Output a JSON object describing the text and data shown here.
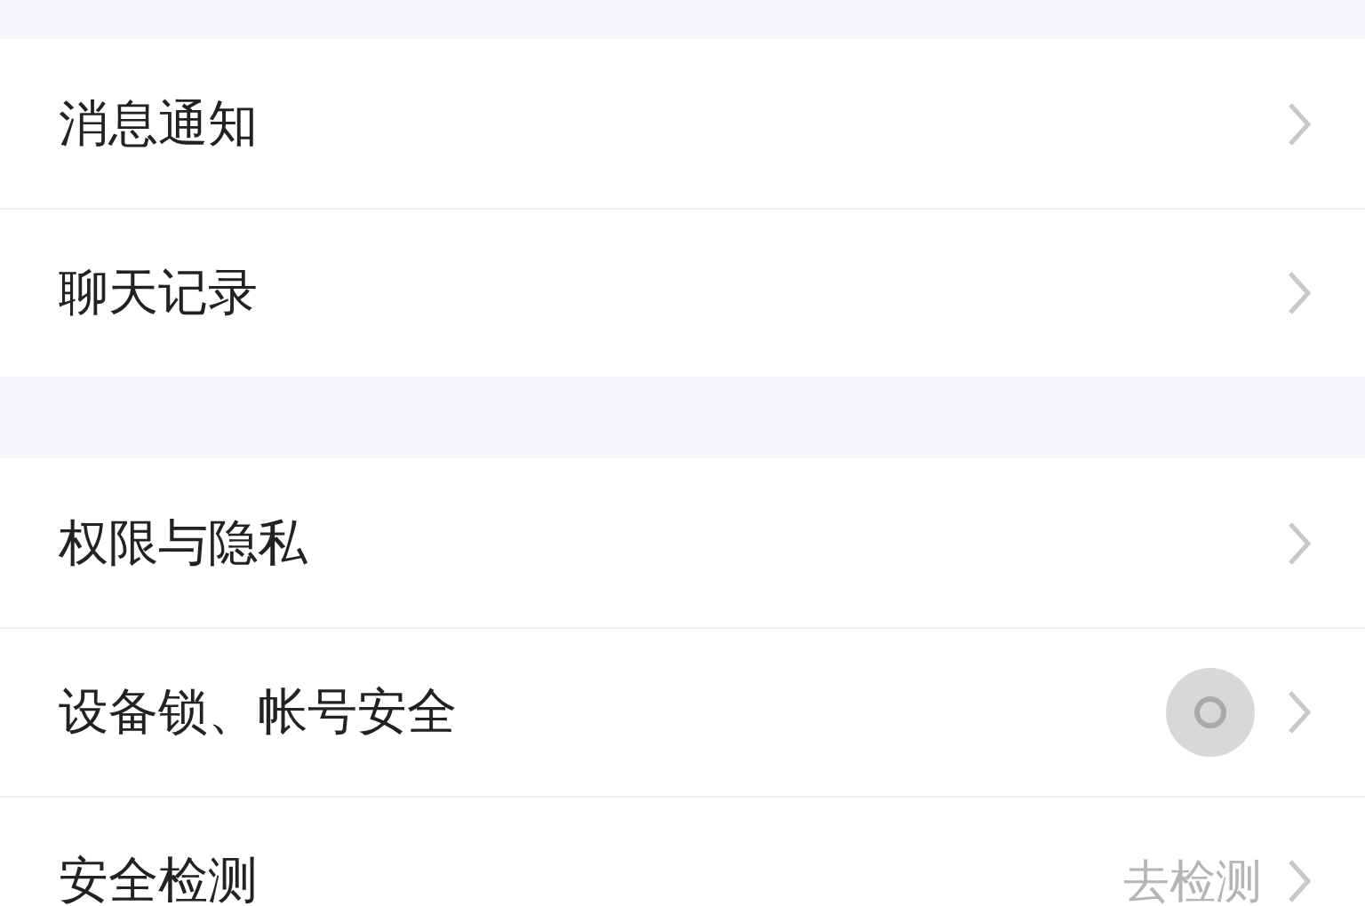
{
  "groups": [
    {
      "items": [
        {
          "label": "消息通知"
        },
        {
          "label": "聊天记录"
        }
      ]
    },
    {
      "items": [
        {
          "label": "权限与隐私"
        },
        {
          "label": "设备锁、帐号安全",
          "badge": true
        },
        {
          "label": "安全检测",
          "value": "去检测"
        }
      ]
    }
  ]
}
